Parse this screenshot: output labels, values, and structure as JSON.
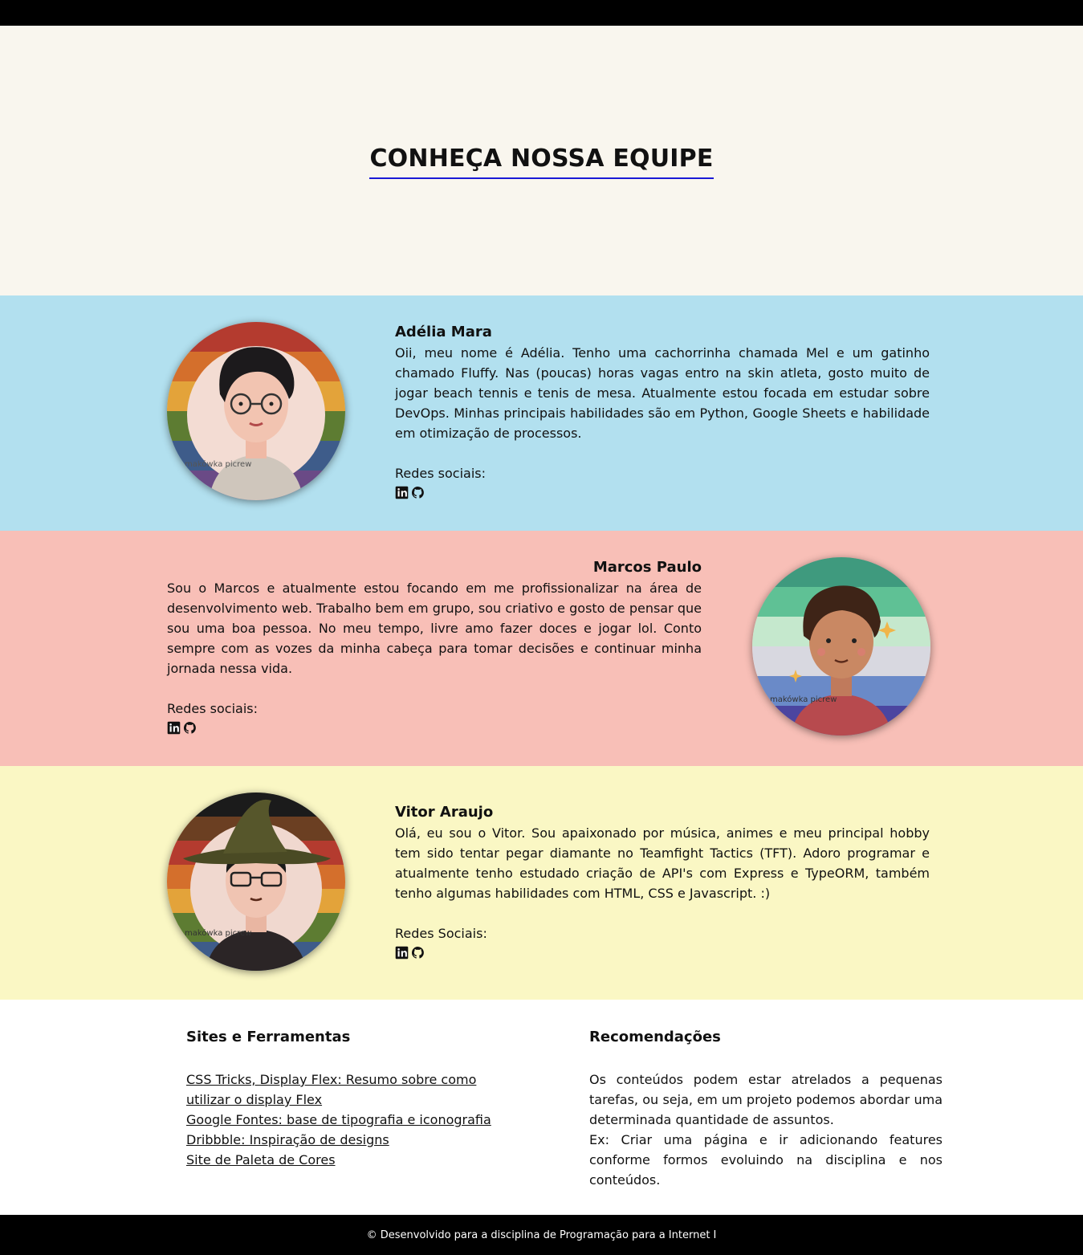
{
  "hero": {
    "title": "CONHEÇA NOSSA EQUIPE"
  },
  "members": [
    {
      "name": "Adélia Mara",
      "bio": "Oii, meu nome é Adélia. Tenho uma cachorrinha chamada Mel e um gatinho chamado Fluffy. Nas (poucas) horas vagas entro na skin atleta, gosto muito de jogar beach tennis e tenis de mesa. Atualmente estou focada em estudar sobre DevOps. Minhas principais habilidades são em Python, Google Sheets e habilidade em otimização de processos.",
      "social_label": "Redes sociais:",
      "avatar_watermark": "makówka picrew",
      "bg_color": "#b2e0ef"
    },
    {
      "name": "Marcos Paulo",
      "bio": "Sou o Marcos e atualmente estou focando em me profissionalizar na área de desenvolvimento web. Trabalho bem em grupo, sou criativo e gosto de pensar que sou uma boa pessoa. No meu tempo, livre amo fazer doces e jogar lol. Conto sempre com as vozes da minha cabeça para tomar decisões e continuar minha jornada nessa vida.",
      "social_label": "Redes sociais:",
      "avatar_watermark": "makówka picrew",
      "bg_color": "#f8bfb7"
    },
    {
      "name": "Vitor Araujo",
      "bio": "Olá, eu sou o Vitor. Sou apaixonado por música, animes e meu principal hobby tem sido tentar pegar diamante no Teamfight Tactics (TFT). Adoro programar e atualmente tenho estudado criação de API's com Express e TypeORM, também tenho algumas habilidades com HTML, CSS e Javascript. :)",
      "social_label": "Redes Sociais:",
      "avatar_watermark": "makówka picrew",
      "bg_color": "#faf7c4"
    }
  ],
  "icons": {
    "linkedin": "linkedin-icon",
    "github": "github-icon"
  },
  "resources": {
    "sites_title": "Sites e Ferramentas",
    "links": [
      "CSS Tricks, Display Flex: Resumo sobre como utilizar o display Flex",
      "Google Fontes: base de tipografia e iconografia",
      "Dribbble: Inspiração de designs",
      "Site de Paleta de Cores"
    ],
    "rec_title": "Recomendações",
    "rec_text_1": "Os conteúdos podem estar atrelados a pequenas tarefas, ou seja, em um projeto podemos abordar uma determinada quantidade de assuntos.",
    "rec_text_2": "Ex: Criar uma página e ir adicionando features conforme formos evoluindo na disciplina e nos conteúdos."
  },
  "footer": {
    "text": "© Desenvolvido para a disciplina de Programação para a Internet I"
  },
  "colors": {
    "accent_underline": "#1a1ad6",
    "hero_bg": "#f9f6ee"
  }
}
